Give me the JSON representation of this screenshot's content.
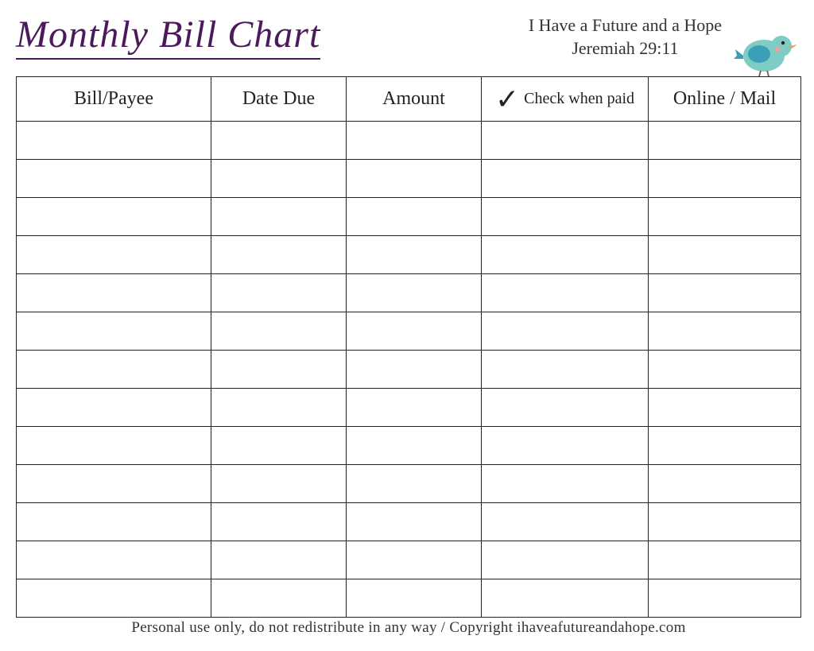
{
  "title": "Monthly Bill Chart",
  "quote_line1": "I Have a Future and a Hope",
  "quote_line2": "Jeremiah 29:11",
  "columns": {
    "payee": "Bill/Payee",
    "date_due": "Date Due",
    "amount": "Amount",
    "check_when_paid": "Check when paid",
    "online_mail": "Online / Mail"
  },
  "row_count": 13,
  "footer": "Personal use only, do not redistribute in any way / Copyright ihaveafutureandahope.com"
}
